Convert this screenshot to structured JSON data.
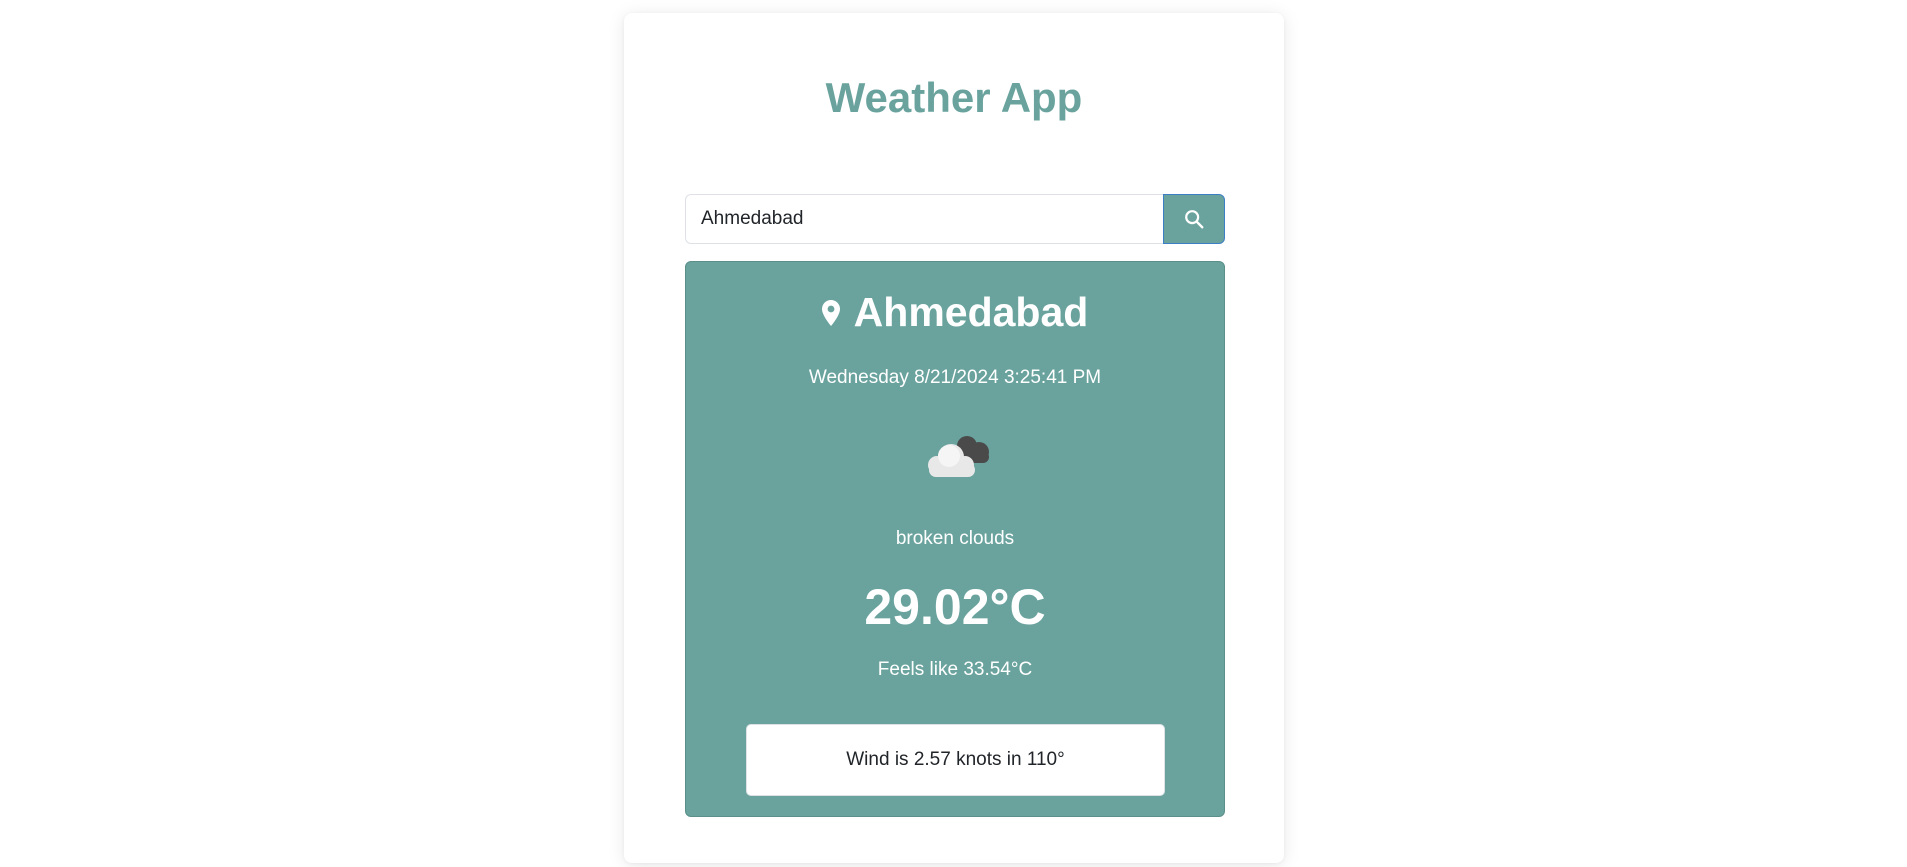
{
  "app": {
    "title": "Weather App"
  },
  "search": {
    "value": "Ahmedabad",
    "button_icon": "search-icon"
  },
  "weather": {
    "location_icon": "map-pin-icon",
    "city": "Ahmedabad",
    "datetime": "Wednesday 8/21/2024 3:25:41 PM",
    "condition_icon": "broken-clouds-icon",
    "description": "broken clouds",
    "temperature": "29.02°C",
    "feels_like": "Feels like 33.54°C",
    "wind": "Wind is 2.57 knots in 110°"
  },
  "colors": {
    "accent": "#6aa39e",
    "button_border": "#3d7fc4",
    "text_dark": "#212529"
  }
}
